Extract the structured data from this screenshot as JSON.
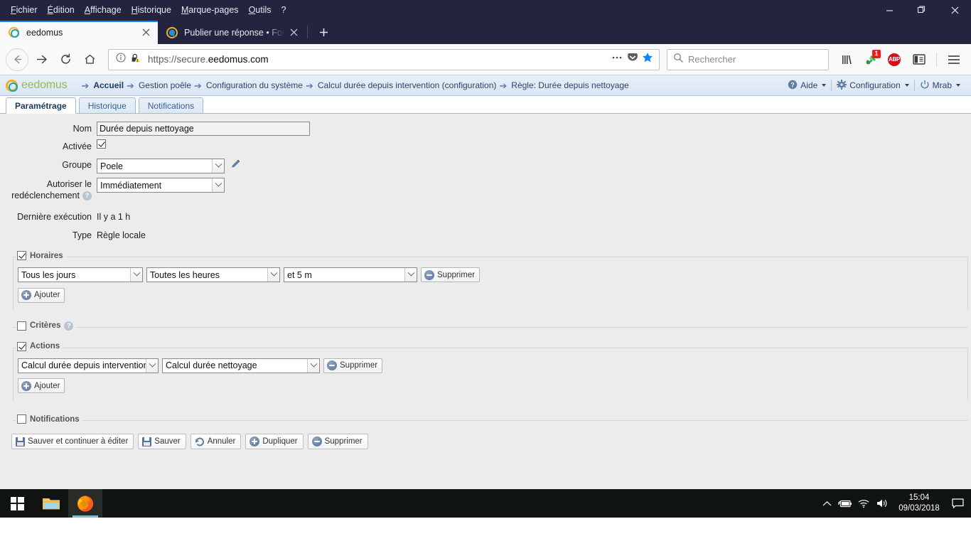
{
  "browser": {
    "menus": [
      {
        "label": "Fichier",
        "accel": "F"
      },
      {
        "label": "Édition",
        "accel": "É"
      },
      {
        "label": "Affichage",
        "accel": "A"
      },
      {
        "label": "Historique",
        "accel": "H"
      },
      {
        "label": "Marque-pages",
        "accel": "M"
      },
      {
        "label": "Outils",
        "accel": "O"
      },
      {
        "label": "?",
        "accel": ""
      }
    ],
    "window_controls": {
      "minimize": "minimize-icon",
      "restore": "restore-icon",
      "close": "close-icon"
    },
    "tabs": [
      {
        "title": "eedomus",
        "active": true,
        "favicon": "eedomus-favicon"
      },
      {
        "title": "Publier une réponse • Forum ee",
        "active": false,
        "favicon": "forum-favicon"
      }
    ],
    "new_tab_label": "+",
    "toolbar": {
      "back": "back-icon",
      "forward": "forward-icon",
      "reload": "reload-icon",
      "home": "home-icon",
      "url_scheme": "https://secure.",
      "url_domain": "eedomus.com",
      "url_full": "https://secure.eedomus.com",
      "identity_icon": "info-icon",
      "lock_warning_icon": "lock-warning-icon",
      "page_actions_icon": "ellipsis-icon",
      "pocket_icon": "pocket-icon",
      "bookmark_icon": "star-icon",
      "search_placeholder": "Rechercher",
      "search_icon": "search-icon",
      "library_icon": "library-icon",
      "extension_badge": "1",
      "extension_icon": "extension-icon",
      "adblock_label": "ABP",
      "sidebar_icon": "sidebar-icon",
      "menu_icon": "hamburger-menu-icon"
    }
  },
  "eedomus": {
    "logo": {
      "prefix": "ee",
      "suffix": "domus"
    },
    "breadcrumbs": [
      "Accueil",
      "Gestion poêle",
      "Configuration du système",
      "Calcul durée depuis intervention (configuration)",
      "Règle: Durée depuis nettoyage"
    ],
    "header_menu": [
      {
        "label": "Aide",
        "icon": "help-icon"
      },
      {
        "label": "Configuration",
        "icon": "gear-icon"
      },
      {
        "label": "Mrab",
        "icon": "power-icon"
      }
    ],
    "tabs": [
      {
        "label": "Paramétrage",
        "active": true
      },
      {
        "label": "Historique",
        "active": false
      },
      {
        "label": "Notifications",
        "active": false
      }
    ],
    "form": {
      "nom_label": "Nom",
      "nom_value": "Durée depuis nettoyage",
      "activee_label": "Activée",
      "activee_checked": true,
      "groupe_label": "Groupe",
      "groupe_value": "Poele",
      "edit_icon": "pencil-icon",
      "redeclenchement_label_line1": "Autoriser le",
      "redeclenchement_label_line2": "redéclenchement",
      "redeclenchement_value": "Immédiatement",
      "derniere_execution_label": "Dernière exécution",
      "derniere_execution_value": "Il y a 1 h",
      "type_label": "Type",
      "type_value": "Règle locale"
    },
    "sections": {
      "horaires": {
        "legend": "Horaires",
        "checked": true,
        "rows": [
          {
            "day": "Tous les jours",
            "hour": "Toutes les heures",
            "minute": "et 5 m",
            "delete_label": "Supprimer"
          }
        ],
        "add_label": "Ajouter"
      },
      "criteres": {
        "legend": "Critères",
        "checked": false,
        "has_help": true
      },
      "actions": {
        "legend": "Actions",
        "checked": true,
        "rows": [
          {
            "target": "Calcul durée depuis intervention",
            "value": "Calcul durée nettoyage",
            "delete_label": "Supprimer"
          }
        ],
        "add_label": "Ajouter"
      },
      "notifications": {
        "legend": "Notifications",
        "checked": false
      }
    },
    "buttons": [
      {
        "label": "Sauver et continuer à éditer",
        "icon": "save-icon"
      },
      {
        "label": "Sauver",
        "icon": "save-icon"
      },
      {
        "label": "Annuler",
        "icon": "undo-icon"
      },
      {
        "label": "Dupliquer",
        "icon": "duplicate-icon"
      },
      {
        "label": "Supprimer",
        "icon": "delete-icon"
      }
    ]
  },
  "taskbar": {
    "start_icon": "windows-start-icon",
    "explorer_icon": "file-explorer-icon",
    "firefox_icon": "firefox-icon",
    "tray": {
      "expand_icon": "chevron-up-icon",
      "battery_icon": "battery-charging-icon",
      "network_icon": "wifi-icon",
      "volume_icon": "volume-icon",
      "time": "15:04",
      "date": "09/03/2018",
      "action_center_icon": "notification-icon"
    }
  }
}
